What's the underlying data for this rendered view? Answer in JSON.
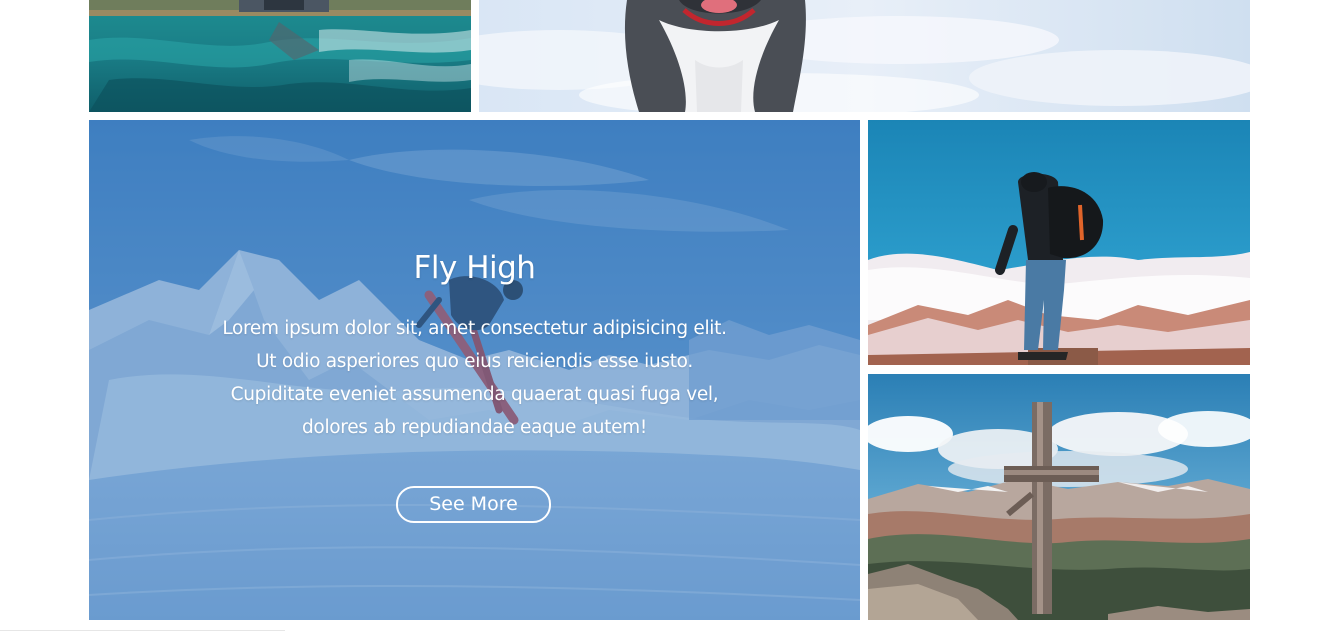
{
  "gallery": {
    "tiles": [
      {
        "name": "lake-photo"
      },
      {
        "name": "husky-photo"
      },
      {
        "name": "ski-jump-photo"
      },
      {
        "name": "hiker-photo"
      },
      {
        "name": "summit-cross-photo"
      }
    ]
  },
  "feature": {
    "title": "Fly High",
    "text": "Lorem ipsum dolor sit, amet consectetur adipisicing elit. Ut odio asperiores quo eius reiciendis esse iusto. Cupiditate eveniet assumenda quaerat quasi fuga vel, dolores ab repudiandae eaque autem!",
    "button_label": "See More",
    "overlay_color": "#3f7fbf"
  }
}
